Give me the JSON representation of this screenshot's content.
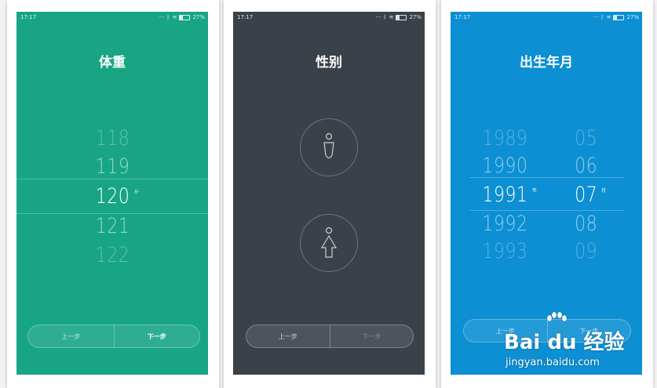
{
  "colors": {
    "weight_bg": "#17a584",
    "gender_bg": "#3a4149",
    "birth_bg": "#0c8fd3"
  },
  "status_time": "17:17",
  "status_battery": "27%",
  "screens": {
    "weight": {
      "title": "体重",
      "items": [
        "118",
        "119",
        "120",
        "121",
        "122"
      ],
      "selected": "120",
      "unit": "斤",
      "prev_label": "上一步",
      "next_label": "下一步"
    },
    "gender": {
      "title": "性别",
      "options": [
        "male-icon",
        "female-icon"
      ],
      "prev_label": "上一步",
      "next_label": "下一步"
    },
    "birth": {
      "title": "出生年月",
      "years": [
        "1989",
        "1990",
        "1991",
        "1992",
        "1993"
      ],
      "selected_year": "1991",
      "year_unit": "年",
      "months": [
        "05",
        "06",
        "07",
        "08",
        "09"
      ],
      "selected_month": "07",
      "month_unit": "月",
      "prev_label": "上一步",
      "next_label": "下一步"
    }
  },
  "watermark": {
    "logo": "Bai du 经验",
    "url": "jingyan.baidu.com"
  }
}
